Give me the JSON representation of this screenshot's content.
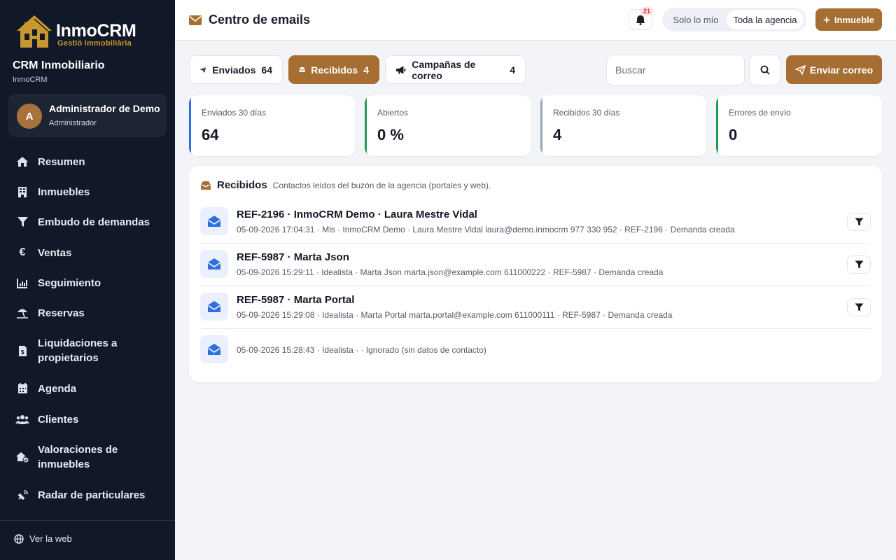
{
  "brand": {
    "logo_title": "InmoCRM",
    "logo_subtitle": "Gestió immobiliària",
    "crm_title": "CRM Inmobiliario",
    "crm_subtitle": "InmoCRM",
    "gold": "#a66e33",
    "sidebar_bg": "#111827"
  },
  "user": {
    "initial": "A",
    "name": "Administrador de Demo",
    "role": "Administrador"
  },
  "nav": {
    "items": [
      {
        "label": "Resumen",
        "icon": "home-icon"
      },
      {
        "label": "Inmuebles",
        "icon": "building-icon"
      },
      {
        "label": "Embudo de demandas",
        "icon": "funnel-icon"
      },
      {
        "label": "Ventas",
        "icon": "euro-icon"
      },
      {
        "label": "Seguimiento",
        "icon": "chart-icon"
      },
      {
        "label": "Reservas",
        "icon": "umbrella-beach-icon"
      },
      {
        "label": "Liquidaciones a propietarios",
        "icon": "invoice-icon"
      },
      {
        "label": "Agenda",
        "icon": "calendar-icon"
      },
      {
        "label": "Clientes",
        "icon": "users-icon"
      },
      {
        "label": "Valoraciones de inmuebles",
        "icon": "house-check-icon"
      },
      {
        "label": "Radar de particulares",
        "icon": "radar-icon"
      }
    ],
    "footer_link": "Ver la web"
  },
  "topbar": {
    "title": "Centro de emails",
    "notifications_count": "21",
    "scope_mine": "Solo lo mío",
    "scope_all": "Toda la agencia",
    "scope_selected": "Toda la agencia",
    "new_property_label": "Inmueble"
  },
  "toolbar": {
    "tabs": [
      {
        "label": "Enviados",
        "count": "64",
        "active": false
      },
      {
        "label": "Recibidos",
        "count": "4",
        "active": true
      },
      {
        "label": "Campañas de correo",
        "count": "4",
        "active": false
      }
    ],
    "search_placeholder": "Buscar",
    "search_value": "",
    "send_label": "Enviar correo"
  },
  "stats": [
    {
      "label": "Enviados 30 días",
      "value": "64",
      "accent": "#2f6fe0"
    },
    {
      "label": "Abiertos",
      "value": "0 %",
      "accent": "#1f9d55"
    },
    {
      "label": "Recibidos 30 días",
      "value": "4",
      "accent": "#9aa5b8"
    },
    {
      "label": "Errores de envío",
      "value": "0",
      "accent": "#1f9d55"
    }
  ],
  "panel": {
    "title": "Recibidos",
    "description": "Contactos leídos del buzón de la agencia (portales y web).",
    "rows": [
      {
        "title": "REF-2196 · InmoCRM Demo · Laura Mestre Vidal",
        "meta": "05-09-2026 17:04:31 · Mls · InmoCRM Demo · Laura Mestre Vidal laura@demo.inmocrm 977 330 952 · REF-2196 · Demanda creada"
      },
      {
        "title": "REF-5987 · Marta Json",
        "meta": "05-09-2026 15:29:11 · Idealista · Marta Json marta.json@example.com 611000222 · REF-5987 · Demanda creada"
      },
      {
        "title": "REF-5987 · Marta Portal",
        "meta": "05-09-2026 15:29:08 · Idealista · Marta Portal marta.portal@example.com 611000111 · REF-5987 · Demanda creada"
      },
      {
        "title": "",
        "meta": "05-09-2026 15:28:43 · Idealista · · Ignorado (sin datos de contacto)"
      }
    ]
  }
}
